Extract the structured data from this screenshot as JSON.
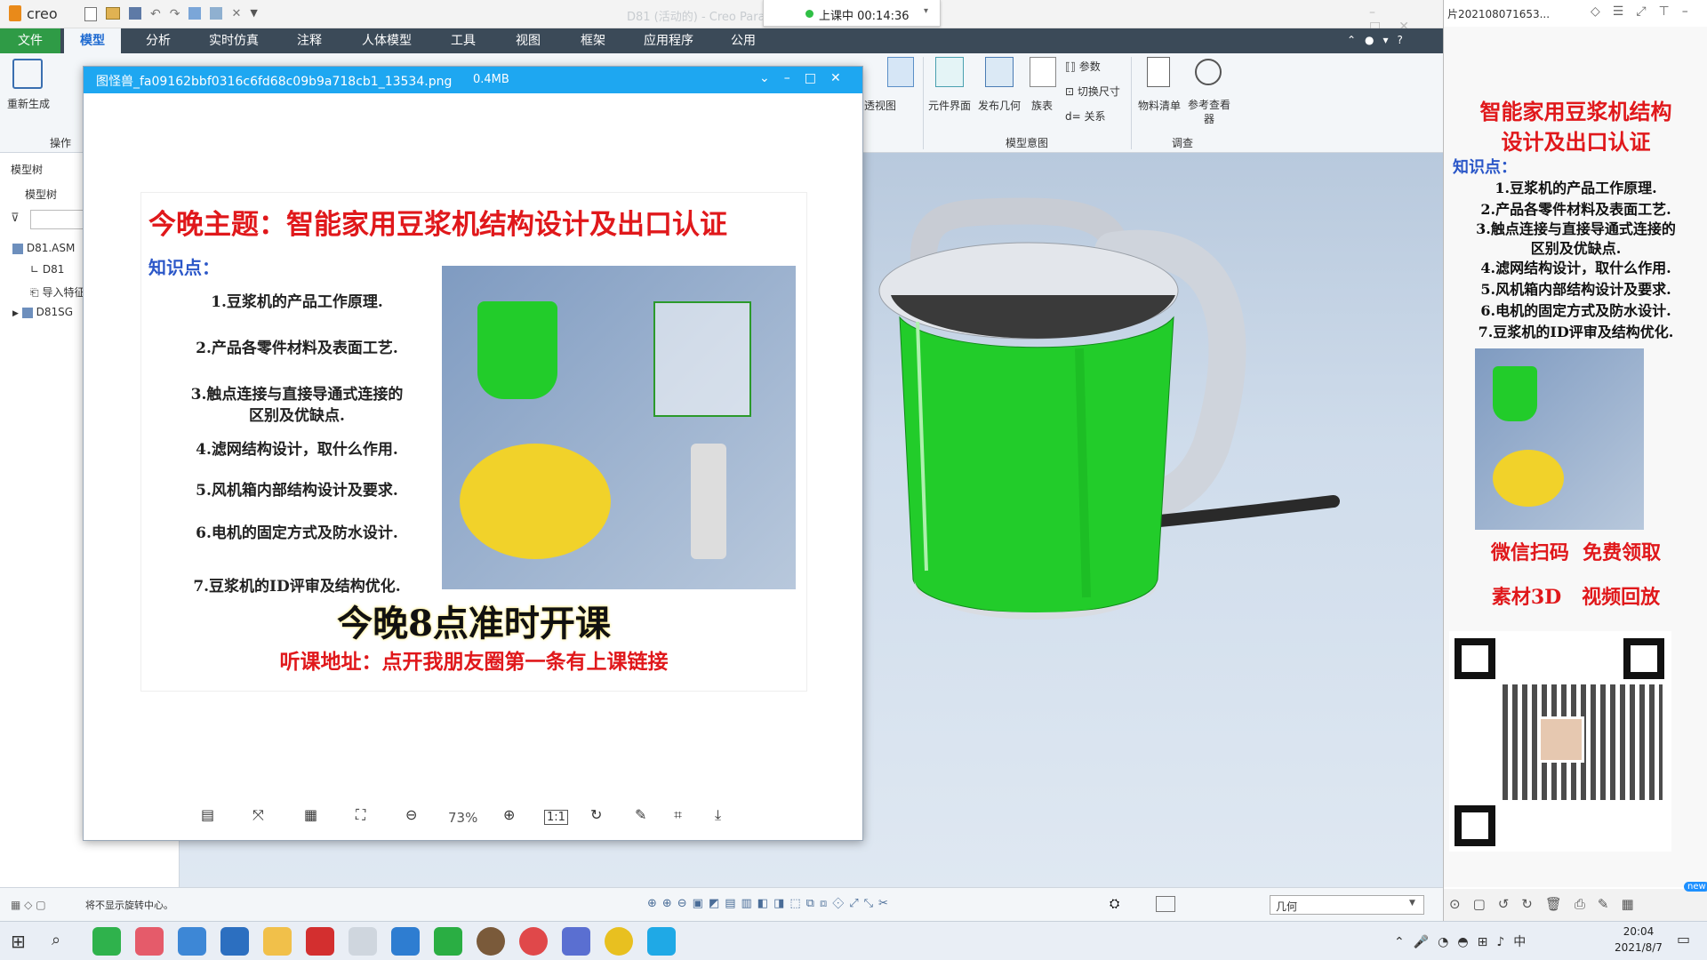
{
  "app": {
    "logo": "creo",
    "window_title": "D81 (活动的) - Creo Para",
    "lesson_status": "上课中 00:14:36",
    "colors": {
      "accent": "#1e6ad1",
      "file_tab": "#2f9b46",
      "ribbon_dark": "#3b4a58",
      "green": "#1fd21f",
      "poster_red": "#e0181b"
    }
  },
  "ribbon": {
    "tabs": [
      "文件",
      "模型",
      "分析",
      "实时仿真",
      "注释",
      "人体模型",
      "工具",
      "视图",
      "框架",
      "应用程序",
      "公用"
    ],
    "active_tab": "模型",
    "regen_label": "重新生成",
    "ops_group": "操作",
    "tools": [
      "透视图",
      "元件界面",
      "发布几何",
      "族表"
    ],
    "small_tools": [
      "参数",
      "切换尺寸",
      "关系"
    ],
    "group_model_intent": "模型意图",
    "bom": "物料清单",
    "ref_viewer": "参考查看器",
    "investigate": "调查"
  },
  "left_panel": {
    "tab_model_tree": "模型树",
    "header": "模型树",
    "items": [
      "D81.ASM",
      "D81",
      "导入特征",
      "D81SG"
    ]
  },
  "viewer": {
    "filename": "图怪兽_fa09162bbf0316c6fd68c09b9a718cb1_13534.png",
    "size": "0.4MB",
    "zoom": "73%",
    "one_to_one": "1:1"
  },
  "poster": {
    "title": "今晚主题：智能家用豆浆机结构设计及出口认证",
    "kp_label": "知识点：",
    "items": [
      "1.豆浆机的产品工作原理.",
      "2.产品各零件材料及表面工艺.",
      "3.触点连接与直接导通式连接的",
      "4.滤网结构设计，取什么作用.",
      "5.风机箱内部结构设计及要求.",
      "6.电机的固定方式及防水设计.",
      "7.豆浆机的ID评审及结构优化."
    ],
    "item3_line2": "区别及优缺点.",
    "big_line": "今晚8点准时开课",
    "address": "听课地址：点开我朋友圈第一条有上课链接"
  },
  "statusbar": {
    "message": "将不显示旋转中心。",
    "filter": "几何"
  },
  "right_panel": {
    "header": "片202108071653...",
    "title_line1": "智能家用豆浆机结构",
    "title_line2": "设计及出口认证",
    "kp_label": "知识点：",
    "items": [
      "1.豆浆机的产品工作原理.",
      "2.产品各零件材料及表面工艺.",
      "3.触点连接与直接导通式连接的",
      "区别及优缺点.",
      "4.滤网结构设计，取什么作用.",
      "5.风机箱内部结构设计及要求.",
      "6.电机的固定方式及防水设计.",
      "7.豆浆机的ID评审及结构优化."
    ],
    "wechat": "微信扫码  免费领取",
    "materials": "素材3D   视频回放",
    "badge_new": "new"
  },
  "taskbar": {
    "time": "20:04",
    "date": "2021/8/7"
  }
}
